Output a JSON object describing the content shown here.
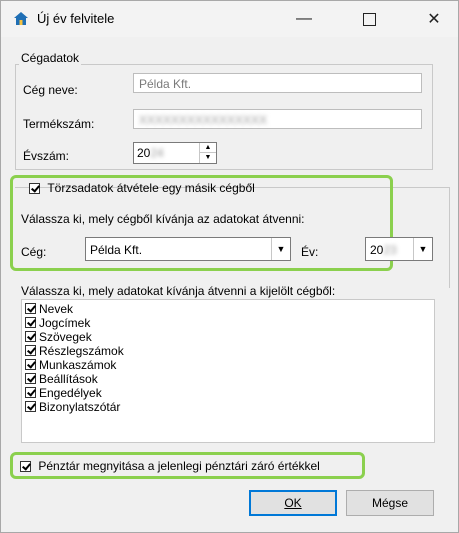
{
  "window": {
    "title": "Új év felvitele",
    "icon": "home-icon",
    "minimize_glyph": "—",
    "close_glyph": "✕"
  },
  "company_group": {
    "legend": "Cégadatok",
    "company_name_label": "Cég neve:",
    "company_name_value": "Példa Kft.",
    "product_number_label": "Termékszám:",
    "product_number_value": "XXXXXXXXXXXXXXXX",
    "year_label": "Évszám:",
    "year_value": "20",
    "year_value_hidden": "24"
  },
  "master_data": {
    "checkbox_label": "Törzsadatok átvétele egy másik cégből",
    "checked": true,
    "instruction": "Válassza ki, mely cégből kívánja az adatokat átvenni:",
    "company_label": "Cég:",
    "company_value": "Példa Kft.",
    "year_label": "Év:",
    "year_value": "20",
    "year_value_hidden": "23"
  },
  "data_list": {
    "instruction": "Válassza ki, mely adatokat kívánja átvenni a kijelölt cégből:",
    "items": [
      {
        "label": "Nevek",
        "checked": true
      },
      {
        "label": "Jogcímek",
        "checked": true
      },
      {
        "label": "Szövegek",
        "checked": true
      },
      {
        "label": "Részlegszámok",
        "checked": true
      },
      {
        "label": "Munkaszámok",
        "checked": true
      },
      {
        "label": "Beállítások",
        "checked": true
      },
      {
        "label": "Engedélyek",
        "checked": true
      },
      {
        "label": "Bizonylatszótár",
        "checked": true
      }
    ]
  },
  "cash_register": {
    "checkbox_label": "Pénztár megnyitása a jelenlegi pénztári záró értékkel",
    "checked": true
  },
  "buttons": {
    "ok_label": "OK",
    "cancel_label": "Mégse"
  },
  "colors": {
    "highlight": "#8bd04e",
    "default_button_border": "#0078d7"
  }
}
